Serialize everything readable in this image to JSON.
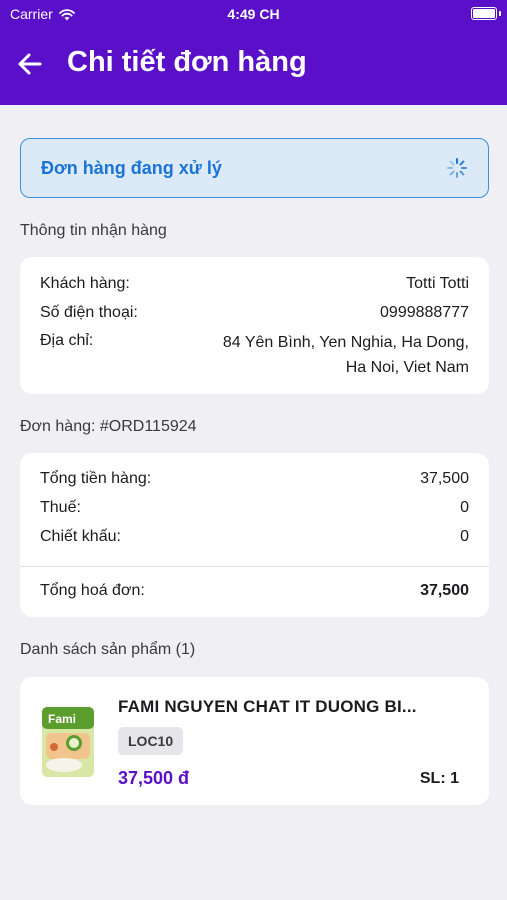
{
  "status_bar": {
    "carrier": "Carrier",
    "time": "4:49 CH"
  },
  "nav": {
    "title": "Chi tiết đơn hàng",
    "back_icon": "arrow-left-icon"
  },
  "order_status": {
    "text": "Đơn hàng đang xử lý",
    "icon": "spinner-icon",
    "color": "#1a74d6"
  },
  "shipping": {
    "section_title": "Thông tin nhận hàng",
    "customer_label": "Khách hàng:",
    "customer_value": "Totti Totti",
    "phone_label": "Số điện thoại:",
    "phone_value": "0999888777",
    "address_label": "Địa chỉ:",
    "address_line1": "84 Yên Bình, Yen Nghia, Ha Dong,",
    "address_line2": "Ha Noi, Viet Nam"
  },
  "order": {
    "section_title": "Đơn hàng: #ORD115924",
    "subtotal_label": "Tổng tiền hàng:",
    "subtotal_value": "37,500",
    "tax_label": "Thuế:",
    "tax_value": "0",
    "discount_label": "Chiết khấu:",
    "discount_value": "0",
    "total_label": "Tổng hoá đơn:",
    "total_value": "37,500"
  },
  "products": {
    "section_title": "Danh sách sản phẩm (1)",
    "items": [
      {
        "name": "FAMI NGUYEN CHAT IT DUONG BI...",
        "sku": "LOC10",
        "price": "37,500 đ",
        "qty": "SL: 1",
        "thumb_text": "Fami"
      }
    ]
  },
  "colors": {
    "brand": "#5a0fc8",
    "status_bg": "#dceaf8",
    "status_border": "#3b8fe0",
    "background": "#efeff4"
  }
}
